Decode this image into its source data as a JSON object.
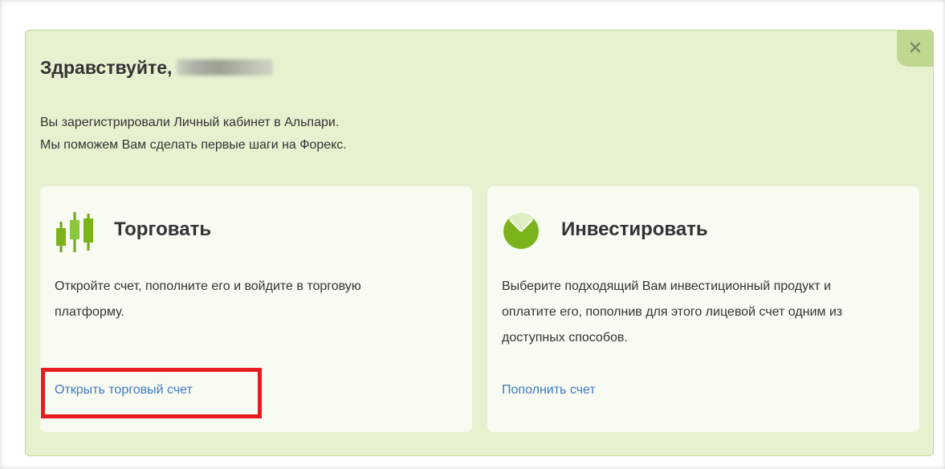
{
  "greeting": {
    "text": "Здравствуйте,",
    "name": ""
  },
  "intro": {
    "line1": "Вы зарегистрировали Личный кабинет в Альпари.",
    "line2": "Мы поможем Вам сделать первые шаги на Форекс."
  },
  "close": {
    "icon": "close-icon"
  },
  "cards": {
    "trade": {
      "icon": "candlestick-chart-icon",
      "title": "Торговать",
      "text": "Откройте счет, пополните его и войдите в торговую платформу.",
      "link": "Открыть торговый счет"
    },
    "invest": {
      "icon": "pie-chart-icon",
      "title": "Инвестировать",
      "text": "Выберите подходящий Вам инвестиционный продукт и оплатите его, пополнив для этого лицевой счет одним из доступных способов.",
      "link": "Пополнить счет"
    }
  },
  "colors": {
    "panel_bg": "#e6f2cf",
    "panel_border": "#bfd898",
    "card_bg": "#f8fbf2",
    "accent_green": "#7bb31a",
    "link_blue": "#3d79c2",
    "highlight_red": "#e81c20"
  }
}
